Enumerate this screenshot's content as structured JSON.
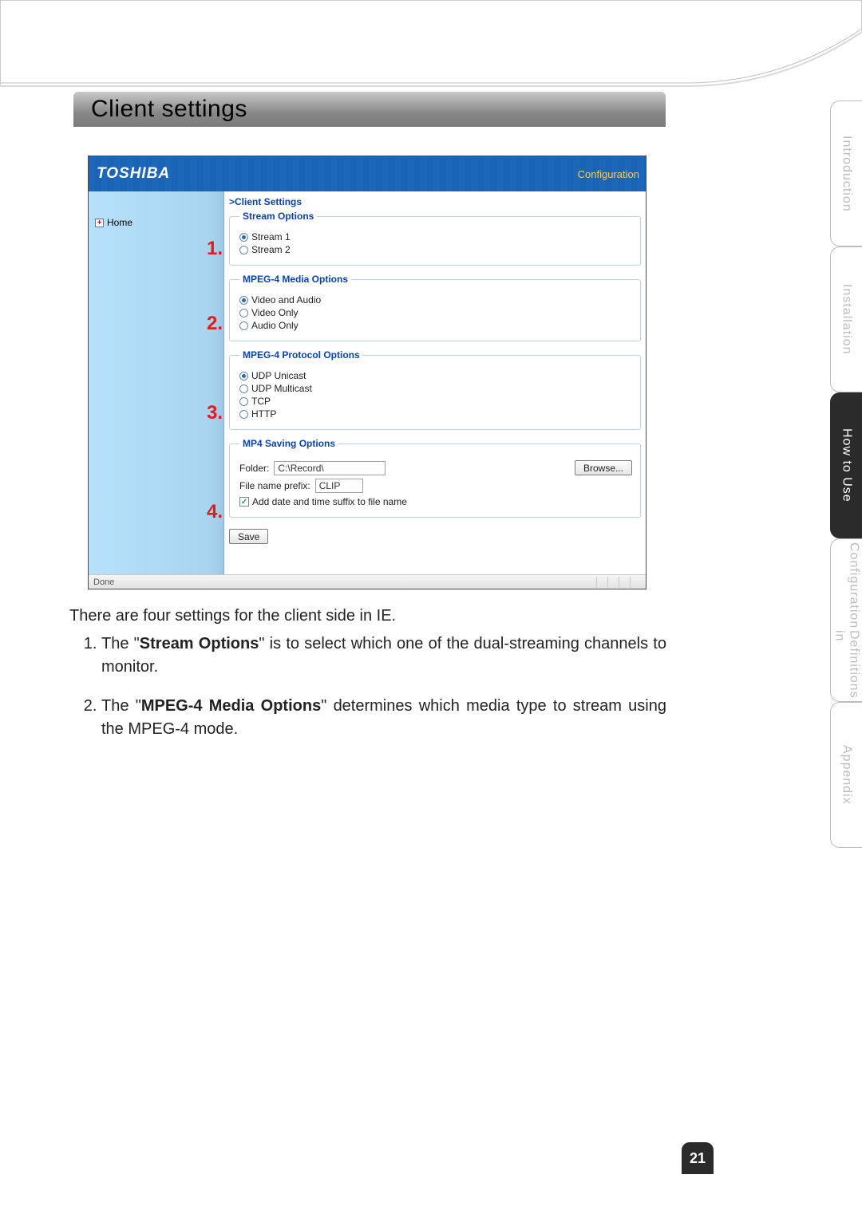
{
  "page": {
    "number": "21"
  },
  "heading": "Client settings",
  "side_tabs": [
    {
      "label": "Introduction",
      "active": false
    },
    {
      "label": "Installation",
      "active": false
    },
    {
      "label": "How to Use",
      "active": true
    },
    {
      "label_line1": "Definitions in",
      "label_line2": "Configuration",
      "active": false
    },
    {
      "label": "Appendix",
      "active": false
    }
  ],
  "ui": {
    "brand": "TOSHIBA",
    "topLink": "Configuration",
    "crumb": "Client Settings",
    "plus": "+",
    "home": "Home",
    "callouts": {
      "n1": "1.",
      "n2": "2.",
      "n3": "3.",
      "n4": "4."
    },
    "stream_options": {
      "legend": "Stream Options",
      "items": [
        {
          "label": "Stream 1",
          "selected": true
        },
        {
          "label": "Stream 2",
          "selected": false
        }
      ]
    },
    "media_options": {
      "legend": "MPEG-4 Media Options",
      "items": [
        {
          "label": "Video and Audio",
          "selected": true
        },
        {
          "label": "Video Only",
          "selected": false
        },
        {
          "label": "Audio Only",
          "selected": false
        }
      ]
    },
    "protocol_options": {
      "legend": "MPEG-4 Protocol Options",
      "items": [
        {
          "label": "UDP Unicast",
          "selected": true
        },
        {
          "label": "UDP Multicast",
          "selected": false
        },
        {
          "label": "TCP",
          "selected": false
        },
        {
          "label": "HTTP",
          "selected": false
        }
      ]
    },
    "saving_options": {
      "legend": "MP4 Saving Options",
      "folder_label": "Folder:",
      "folder_value": "C:\\Record\\",
      "browse": "Browse...",
      "prefix_label": "File name prefix:",
      "prefix_value": "CLIP",
      "checkbox_label": "Add date and time suffix to file name",
      "checkbox_on": "✓"
    },
    "save": "Save",
    "status": "Done"
  },
  "body": {
    "intro": "There are four settings for the client side in IE.",
    "item1_pre": "The \"",
    "item1_bold": "Stream Options",
    "item1_post": "\" is to select which one of the dual-streaming channels to monitor.",
    "item2_pre": "The \"",
    "item2_bold": "MPEG-4 Media Options",
    "item2_post": "\" determines which media type to stream using the MPEG-4 mode."
  }
}
